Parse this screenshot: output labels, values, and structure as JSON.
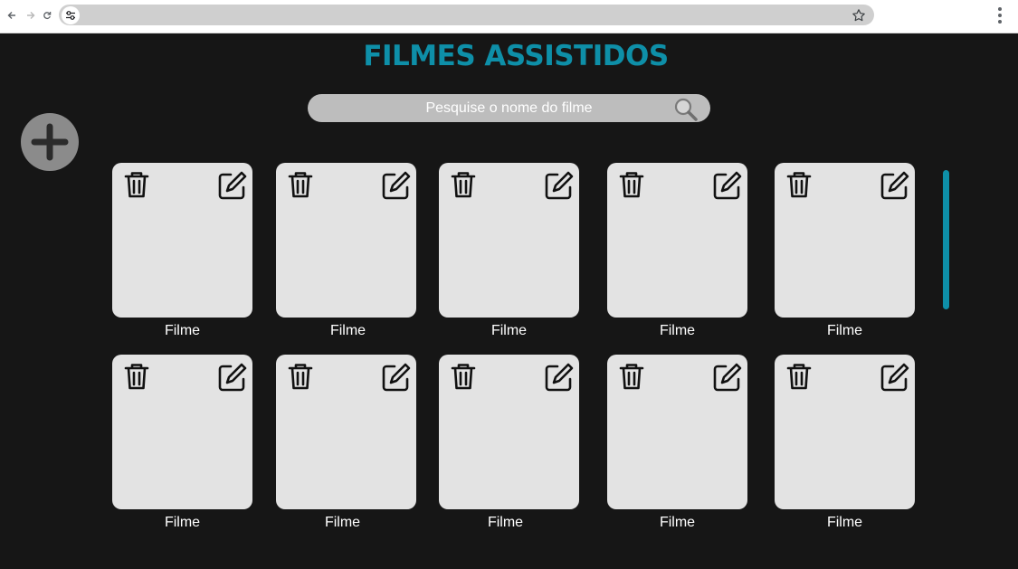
{
  "page": {
    "title": "FILMES ASSISTIDOS",
    "title_color": "#0e8fa8",
    "background": "#161616"
  },
  "search": {
    "placeholder": "Pesquise o nome do filme",
    "value": ""
  },
  "icons": {
    "back": "arrow-left-icon",
    "forward": "arrow-right-icon",
    "reload": "reload-icon",
    "site_info": "tune-icon",
    "bookmark": "star-icon",
    "menu": "kebab-menu-icon",
    "search": "magnifier-icon",
    "add": "plus-icon",
    "delete": "trash-icon",
    "edit": "edit-icon"
  },
  "movies": [
    {
      "title": "Filme"
    },
    {
      "title": "Filme"
    },
    {
      "title": "Filme"
    },
    {
      "title": "Filme"
    },
    {
      "title": "Filme"
    },
    {
      "title": "Filme"
    },
    {
      "title": "Filme"
    },
    {
      "title": "Filme"
    },
    {
      "title": "Filme"
    },
    {
      "title": "Filme"
    }
  ],
  "colors": {
    "card": "#e3e3e3",
    "accent": "#0e8fa8",
    "add_button": "#8b8b8b",
    "search_bar": "#bdbdbd"
  }
}
